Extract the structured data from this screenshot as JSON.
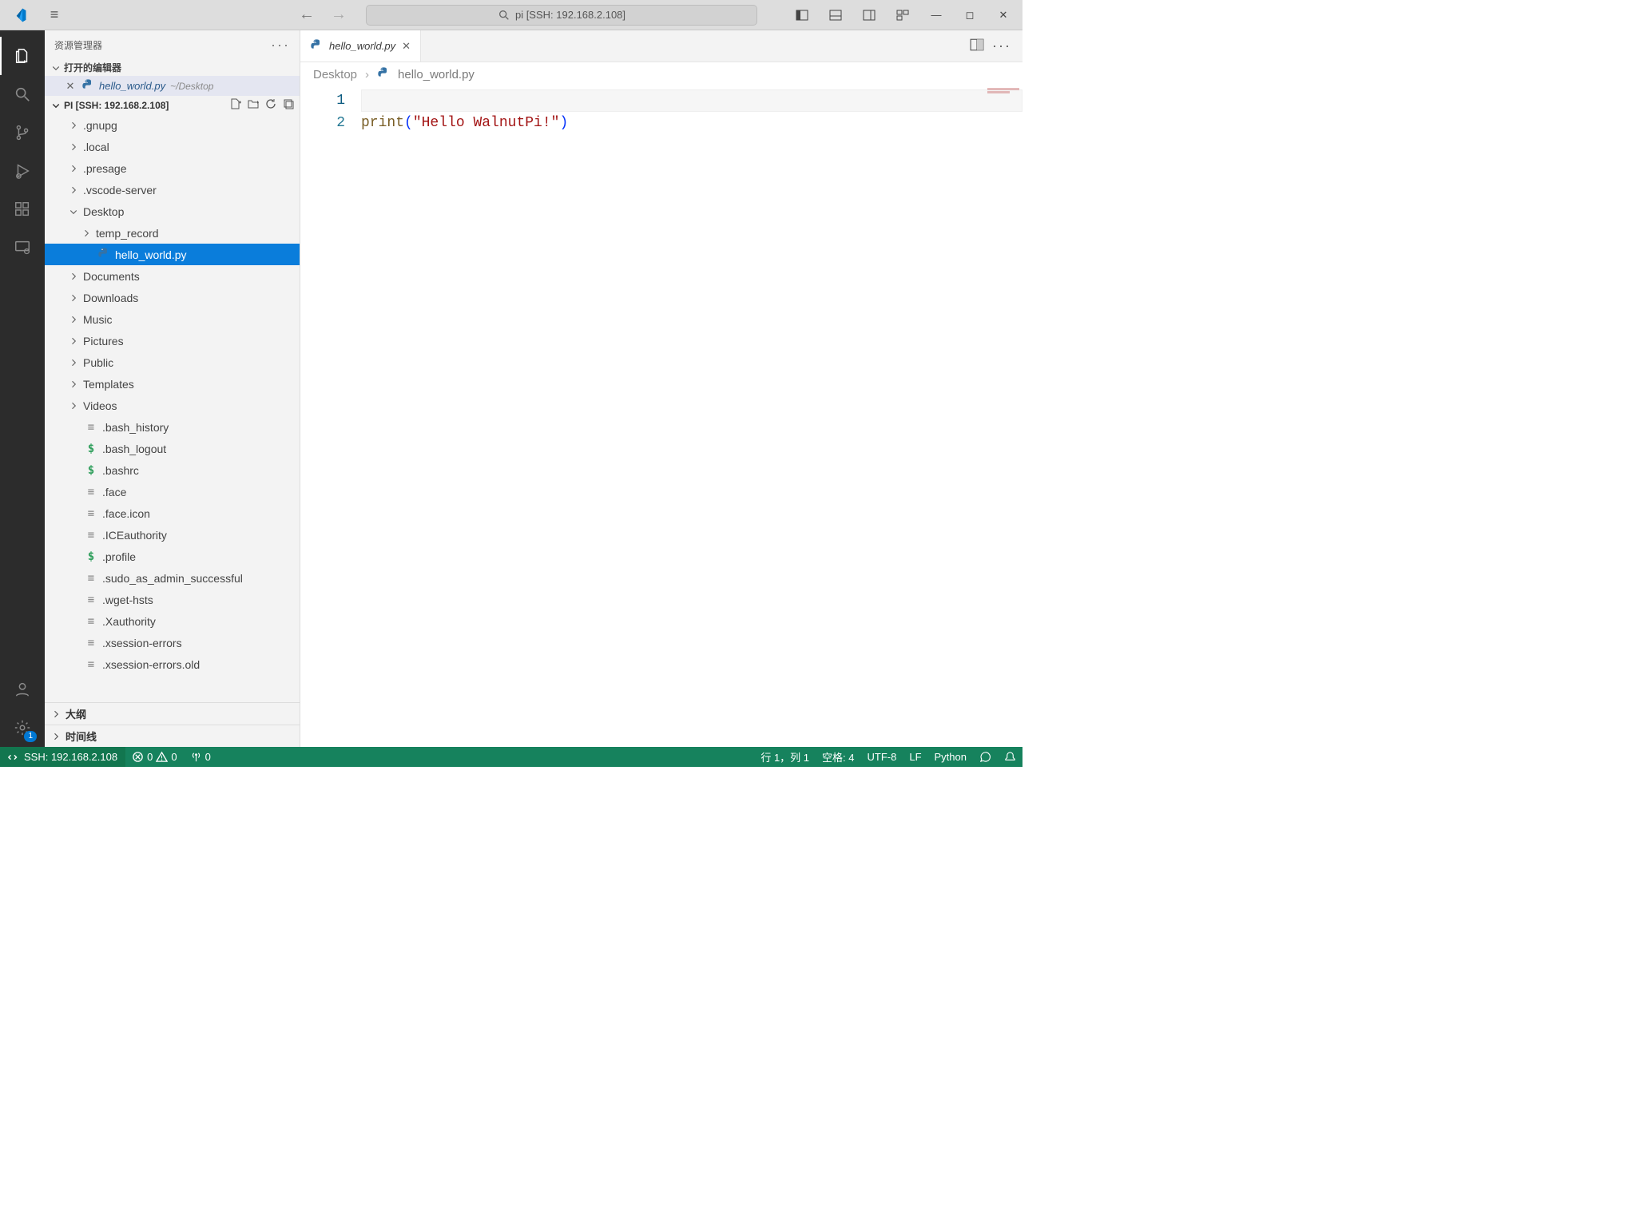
{
  "titlebar": {
    "search_text": "pi [SSH: 192.168.2.108]"
  },
  "sidebar": {
    "title": "资源管理器",
    "open_editors_label": "打开的编辑器",
    "open_editor": {
      "name": "hello_world.py",
      "path": "~/Desktop"
    },
    "workspace_label": "PI [SSH: 192.168.2.108]",
    "tree": [
      {
        "type": "folder",
        "name": ".gnupg",
        "depth": 1,
        "expanded": false
      },
      {
        "type": "folder",
        "name": ".local",
        "depth": 1,
        "expanded": false
      },
      {
        "type": "folder",
        "name": ".presage",
        "depth": 1,
        "expanded": false
      },
      {
        "type": "folder",
        "name": ".vscode-server",
        "depth": 1,
        "expanded": false
      },
      {
        "type": "folder",
        "name": "Desktop",
        "depth": 1,
        "expanded": true
      },
      {
        "type": "folder",
        "name": "temp_record",
        "depth": 2,
        "expanded": false
      },
      {
        "type": "file",
        "name": "hello_world.py",
        "depth": 2,
        "icon": "python",
        "selected": true
      },
      {
        "type": "folder",
        "name": "Documents",
        "depth": 1,
        "expanded": false
      },
      {
        "type": "folder",
        "name": "Downloads",
        "depth": 1,
        "expanded": false
      },
      {
        "type": "folder",
        "name": "Music",
        "depth": 1,
        "expanded": false
      },
      {
        "type": "folder",
        "name": "Pictures",
        "depth": 1,
        "expanded": false
      },
      {
        "type": "folder",
        "name": "Public",
        "depth": 1,
        "expanded": false
      },
      {
        "type": "folder",
        "name": "Templates",
        "depth": 1,
        "expanded": false
      },
      {
        "type": "folder",
        "name": "Videos",
        "depth": 1,
        "expanded": false
      },
      {
        "type": "file",
        "name": ".bash_history",
        "depth": 1,
        "icon": "text"
      },
      {
        "type": "file",
        "name": ".bash_logout",
        "depth": 1,
        "icon": "shell"
      },
      {
        "type": "file",
        "name": ".bashrc",
        "depth": 1,
        "icon": "shell"
      },
      {
        "type": "file",
        "name": ".face",
        "depth": 1,
        "icon": "text"
      },
      {
        "type": "file",
        "name": ".face.icon",
        "depth": 1,
        "icon": "text"
      },
      {
        "type": "file",
        "name": ".ICEauthority",
        "depth": 1,
        "icon": "text"
      },
      {
        "type": "file",
        "name": ".profile",
        "depth": 1,
        "icon": "shell"
      },
      {
        "type": "file",
        "name": ".sudo_as_admin_successful",
        "depth": 1,
        "icon": "text"
      },
      {
        "type": "file",
        "name": ".wget-hsts",
        "depth": 1,
        "icon": "text"
      },
      {
        "type": "file",
        "name": ".Xauthority",
        "depth": 1,
        "icon": "text"
      },
      {
        "type": "file",
        "name": ".xsession-errors",
        "depth": 1,
        "icon": "text"
      },
      {
        "type": "file",
        "name": ".xsession-errors.old",
        "depth": 1,
        "icon": "text"
      }
    ],
    "outline_label": "大纲",
    "timeline_label": "时间线"
  },
  "editor": {
    "tab_name": "hello_world.py",
    "breadcrumb_root": "Desktop",
    "breadcrumb_file": "hello_world.py",
    "lines": {
      "1": "",
      "2_fn": "print",
      "2_open": "(",
      "2_str": "\"Hello WalnutPi!\"",
      "2_close": ")"
    }
  },
  "statusbar": {
    "remote": "SSH: 192.168.2.108",
    "errors": "0",
    "warnings": "0",
    "ports": "0",
    "line_col": "行 1，列 1",
    "spaces": "空格: 4",
    "encoding": "UTF-8",
    "eol": "LF",
    "lang": "Python"
  },
  "activitybar": {
    "settings_badge": "1"
  },
  "colors": {
    "accent": "#0078d4",
    "status": "#16825d"
  }
}
